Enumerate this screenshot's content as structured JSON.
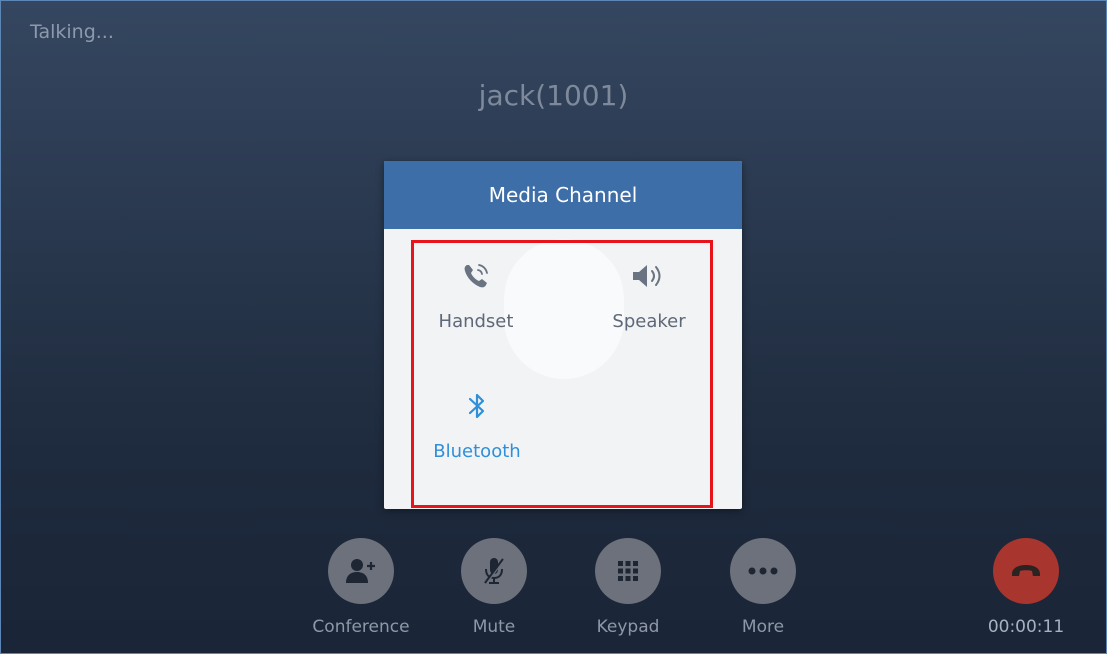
{
  "call": {
    "status": "Talking...",
    "caller": "jack(1001)",
    "timer": "00:00:11"
  },
  "dialog": {
    "title": "Media Channel",
    "options": [
      {
        "label": "Handset",
        "icon": "handset-icon",
        "selected": false
      },
      {
        "label": "Speaker",
        "icon": "speaker-icon",
        "selected": false
      },
      {
        "label": "Bluetooth",
        "icon": "bluetooth-icon",
        "selected": true
      }
    ]
  },
  "toolbar": {
    "conference_label": "Conference",
    "mute_label": "Mute",
    "keypad_label": "Keypad",
    "more_label": "More"
  },
  "colors": {
    "dialog_header": "#3e6ea8",
    "selected_option": "#2f8fd8",
    "highlight_box": "#e8141c",
    "hangup_button": "#a8352e"
  }
}
